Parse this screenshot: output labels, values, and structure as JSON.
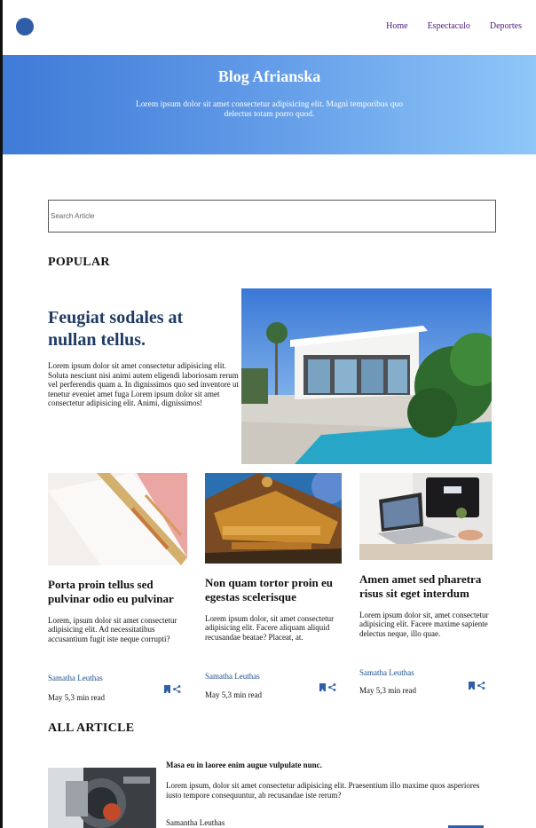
{
  "nav": {
    "links": [
      "Home",
      "Espectaculo",
      "Deportes"
    ]
  },
  "hero": {
    "title": "Blog Afrianska",
    "subtitle": "Lorem ipsum dolor sit amet consectetur adipisicing elit. Magni temporibus quo delectus totam porro quod."
  },
  "search": {
    "placeholder": "Search Article",
    "value": ""
  },
  "popular": {
    "heading": "POPULAR",
    "featured": {
      "title": "Feugiat sodales at nullan tellus.",
      "text": "Lorem ipsum dolor sit amet consectetur adipisicing elit. Soluta nesciunt nisi animi autem eligendi laboriosam rerum vel perferendis quam a. In dignissimos quo sed inventore ut tenetur eveniet amet fuga Lorem ipsum dolor sit amet consectetur adipisicing elit. Animi, dignissimos!"
    },
    "cards": [
      {
        "title": "Porta proin tellus sed pulvinar odio eu pulvinar",
        "text": "Lorem, ipsum dolor sit amet consectetur adipisicing elit. Ad necessitatibus accusantium fugit iste neque corrupti?",
        "author": "Samatha Leuthas",
        "meta": "May 5,3 min read"
      },
      {
        "title": "Non quam tortor proin eu egestas scelerisque",
        "text": "Lorem ipsum dolor, sit amet consectetur adipisicing elit. Facere aliquam aliquid recusandae beatae? Placeat, at.",
        "author": "Samatha Leuthas",
        "meta": "May 5,3 min read"
      },
      {
        "title": "Amen amet sed pharetra risus sit eget interdum",
        "text": "Lorem ipsum dolor sit, amet consectetur adipisicing elit. Facere maxime sapiente delectus neque, illo quae.",
        "author": "Samatha Leuthas",
        "meta": "May 5,3 min read"
      }
    ]
  },
  "all_article": {
    "heading": "ALL ARTICLE",
    "item": {
      "title": "Masa eu in laoree enim augue vulpulate nunc.",
      "text": "Lorem ipsum, dolor sit amet consectetur adipisicing elit. Praesentium illo maxime quos asperiores iusto tempore consequuntur, ab recusandae iste rerum?",
      "author": "Samantha Leuthas"
    }
  },
  "icons": {
    "bookmark": "bookmark-icon",
    "share": "share-icon"
  },
  "colors": {
    "hero_start": "#3f7bd8",
    "hero_end": "#8ec7f8",
    "accent": "#2f5da8",
    "nav_link": "#4a1a7a",
    "featured_title": "#1f3b64"
  }
}
